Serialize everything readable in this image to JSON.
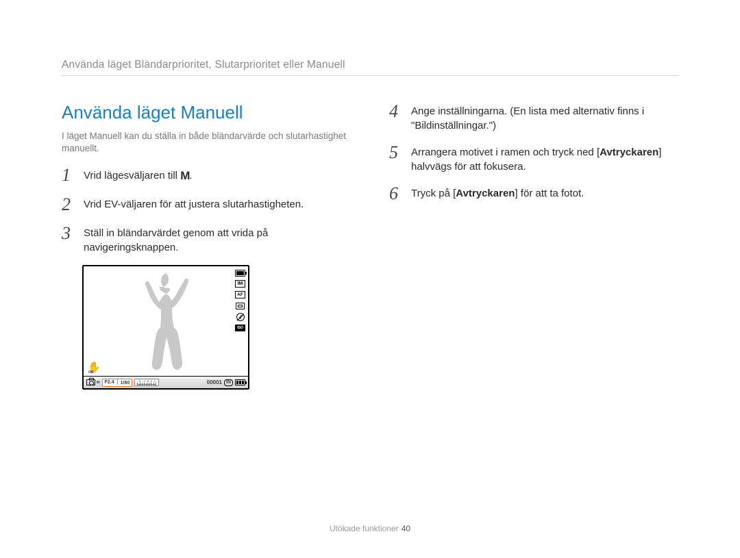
{
  "breadcrumb": "Använda läget Bländarprioritet, Slutarprioritet eller Manuell",
  "section_title": "Använda läget Manuell",
  "intro": "I läget Manuell kan du ställa in både bländarvärde och slutarhastighet manuellt.",
  "steps_left": {
    "1": {
      "num": "1",
      "pre": "Vrid lägesväljaren till ",
      "mode": "M",
      "post": "."
    },
    "2": {
      "num": "2",
      "text": "Vrid EV-väljaren för att justera slutarhastigheten."
    },
    "3": {
      "num": "3",
      "text": "Ställ in bländarvärdet genom att vrida på navigeringsknappen."
    }
  },
  "steps_right": {
    "4": {
      "num": "4",
      "text": "Ange inställningarna. (En lista med alternativ finns i \"Bildinställningar.\")"
    },
    "5": {
      "num": "5",
      "pre": "Arrangera motivet i ramen och tryck ned [",
      "bold": "Avtryckaren",
      "post": "] halvvägs för att fokusera."
    },
    "6": {
      "num": "6",
      "pre": "Tryck på [",
      "bold": "Avtryckaren",
      "post": "] för att ta fotot."
    }
  },
  "camera": {
    "icons": {
      "mode_overlay": "IM",
      "af": "AF",
      "iso": "ISO",
      "ois": "OIS"
    },
    "bottom": {
      "mode_m": "M",
      "f": "F2.4",
      "shutter": "1/60",
      "counter": "00001",
      "in": "IN"
    }
  },
  "footer": {
    "label": "Utökade funktioner",
    "page": "40"
  }
}
